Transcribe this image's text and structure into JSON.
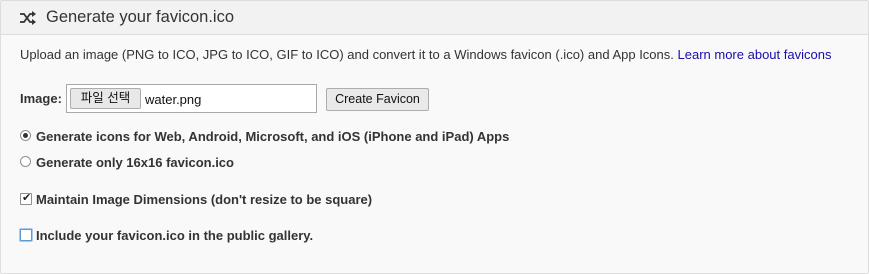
{
  "header": {
    "icon": "shuffle-icon",
    "title": "Generate your favicon.ico"
  },
  "intro": {
    "text": "Upload an image (PNG to ICO, JPG to ICO, GIF to ICO) and convert it to a Windows favicon (.ico) and App Icons.",
    "link": "Learn more about favicons"
  },
  "form": {
    "image_label": "Image:",
    "file_button": "파일 선택",
    "file_name": "water.png",
    "create_button": "Create Favicon"
  },
  "options": {
    "radio_all": {
      "label": "Generate icons for Web, Android, Microsoft, and iOS (iPhone and iPad) Apps",
      "checked": true
    },
    "radio_16": {
      "label": "Generate only 16x16 favicon.ico",
      "checked": false
    },
    "maintain_dimensions": {
      "label": "Maintain Image Dimensions (don't resize to be square)",
      "checked": true
    },
    "public_gallery": {
      "label": "Include your favicon.ico in the public gallery.",
      "checked": false
    }
  },
  "colors": {
    "link": "#1a0dab",
    "heading_bg": "#f2f2f2",
    "panel_bg": "#f9f9f9",
    "focus_outline": "#5b9bd5"
  }
}
